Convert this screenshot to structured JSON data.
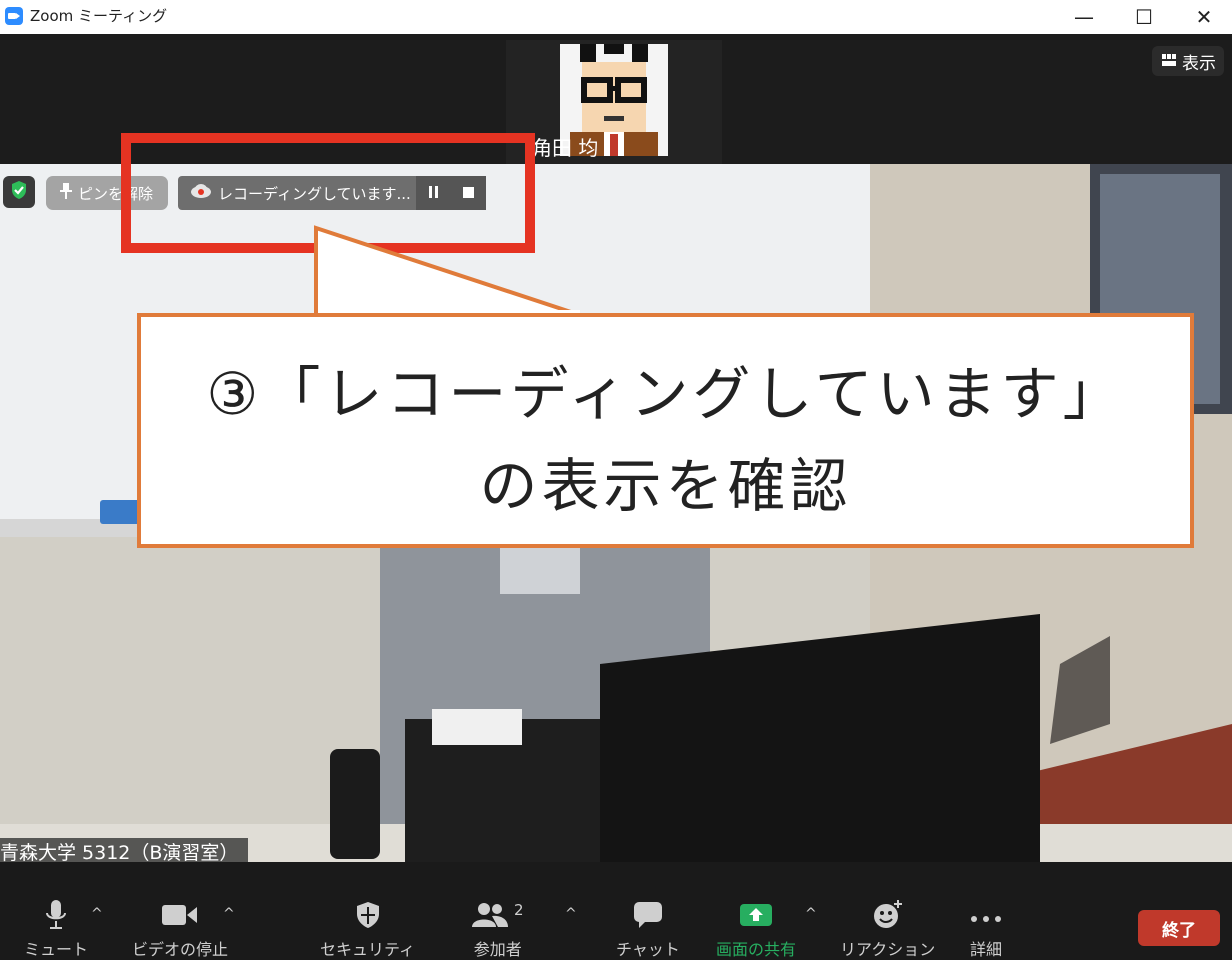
{
  "window": {
    "title": "Zoom ミーティング",
    "minimize": "—",
    "maximize": "☐",
    "close": "✕"
  },
  "top": {
    "participant_name": "角田 均",
    "view_button": "表示"
  },
  "overlay": {
    "unpin_label": "ピンを解除",
    "recording_label": "レコーディングしています..."
  },
  "video": {
    "name_tag": "青森大学 5312（B演習室）"
  },
  "annotation": {
    "line1": "③「レコーディングしています」",
    "line2": "の表示を確認",
    "frame_color": "#e53322",
    "callout_border_color": "#e07b3a"
  },
  "toolbar": {
    "mute": "ミュート",
    "video_stop": "ビデオの停止",
    "security": "セキュリティ",
    "participants": "参加者",
    "participants_count": "2",
    "chat": "チャット",
    "share_screen": "画面の共有",
    "reactions": "リアクション",
    "more": "詳細",
    "end": "終了",
    "share_color": "#27ae60",
    "end_color": "#c0392b"
  }
}
